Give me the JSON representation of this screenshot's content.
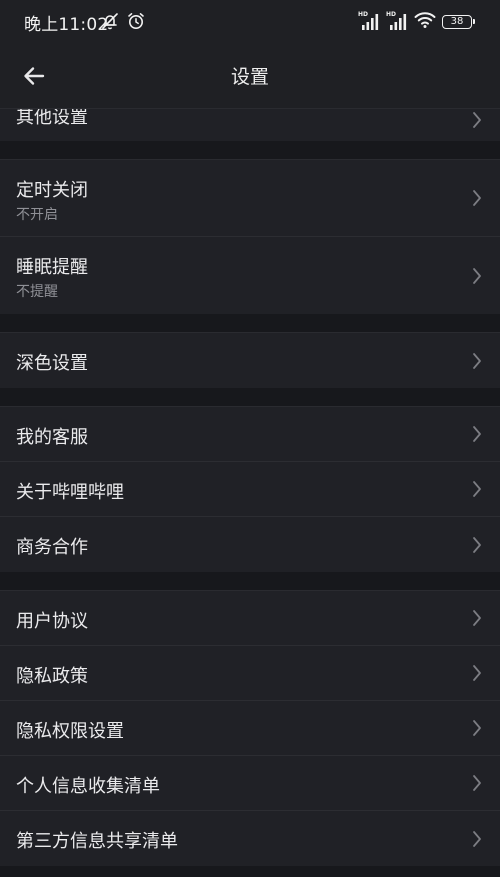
{
  "status_bar": {
    "time": "晚上11:02",
    "battery": "38",
    "signal_label": "HD",
    "icons": [
      "mute-bell-icon",
      "alarm-icon",
      "signal-icon",
      "wifi-icon",
      "battery-icon"
    ]
  },
  "nav": {
    "title": "设置",
    "back_icon": "back-arrow-icon"
  },
  "groups": [
    {
      "items": [
        {
          "label": "其他设置"
        }
      ]
    },
    {
      "items": [
        {
          "label": "定时关闭",
          "sub": "不开启"
        },
        {
          "label": "睡眠提醒",
          "sub": "不提醒"
        }
      ]
    },
    {
      "items": [
        {
          "label": "深色设置"
        }
      ]
    },
    {
      "items": [
        {
          "label": "我的客服"
        },
        {
          "label": "关于哔哩哔哩"
        },
        {
          "label": "商务合作"
        }
      ]
    },
    {
      "items": [
        {
          "label": "用户协议"
        },
        {
          "label": "隐私政策"
        },
        {
          "label": "隐私权限设置"
        },
        {
          "label": "个人信息收集清单"
        },
        {
          "label": "第三方信息共享清单"
        }
      ]
    }
  ],
  "colors": {
    "background": "#17181c",
    "row_background": "#202126",
    "text": "#eaeaec",
    "subtext": "#8f9096",
    "chevron": "#7c7d83"
  }
}
